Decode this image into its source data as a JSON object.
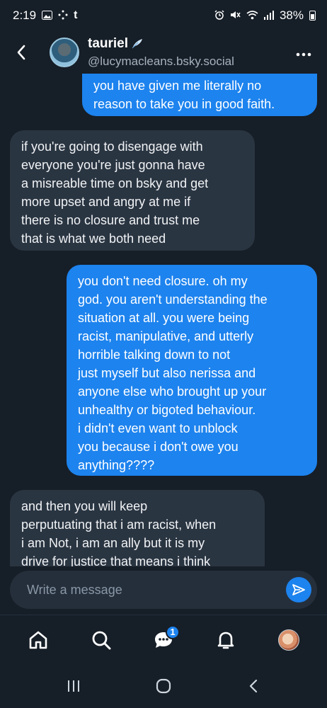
{
  "status_bar": {
    "time": "2:19",
    "left_icons": [
      "gallery-icon",
      "dots-icon",
      "tumblr-icon"
    ],
    "battery": "38%",
    "right_icons": [
      "alarm-icon",
      "mute-icon",
      "wifi-icon",
      "signal-icon",
      "battery-icon"
    ]
  },
  "header": {
    "name": "tauriel",
    "handle": "@lucymacleans.bsky.social",
    "more_label": "•••"
  },
  "messages": [
    {
      "from": "me",
      "lines": [
        "you have given me literally no",
        "reason to take you in good faith."
      ]
    },
    {
      "from": "them",
      "lines": [
        "if you're going to disengage with",
        "everyone you're just gonna have",
        "a misreable time on bsky and get",
        "more upset and angry at me if",
        "there is no closure and trust me",
        "that is what we both need"
      ]
    },
    {
      "from": "me",
      "lines": [
        "you don't need closure. oh my",
        "god. you aren't understanding the",
        "situation at all. you were being",
        "racist, manipulative, and utterly",
        "horrible talking down to not",
        "just myself but also nerissa and",
        "anyone else who brought up your",
        "unhealthy or bigoted behaviour.",
        "i didn't even want to unblock",
        "you because i don't owe you",
        "anything????"
      ]
    },
    {
      "from": "them",
      "lines": [
        "and then you will keep",
        "perputuating that i am racist, when",
        "i am Not, i am an ally but it is my",
        "drive for justice that means i think"
      ]
    }
  ],
  "composer": {
    "placeholder": "Write a message"
  },
  "bottom_nav": {
    "items": [
      "home-icon",
      "search-icon",
      "chat-icon",
      "bell-icon",
      "profile-avatar"
    ],
    "chat_badge": "1"
  },
  "system_nav": [
    "recents-icon",
    "home-circle-icon",
    "back-icon"
  ],
  "colors": {
    "background": "#161e27",
    "my_bubble": "#1d83ee",
    "their_bubble": "#2a3542",
    "accent": "#1d83ee"
  }
}
